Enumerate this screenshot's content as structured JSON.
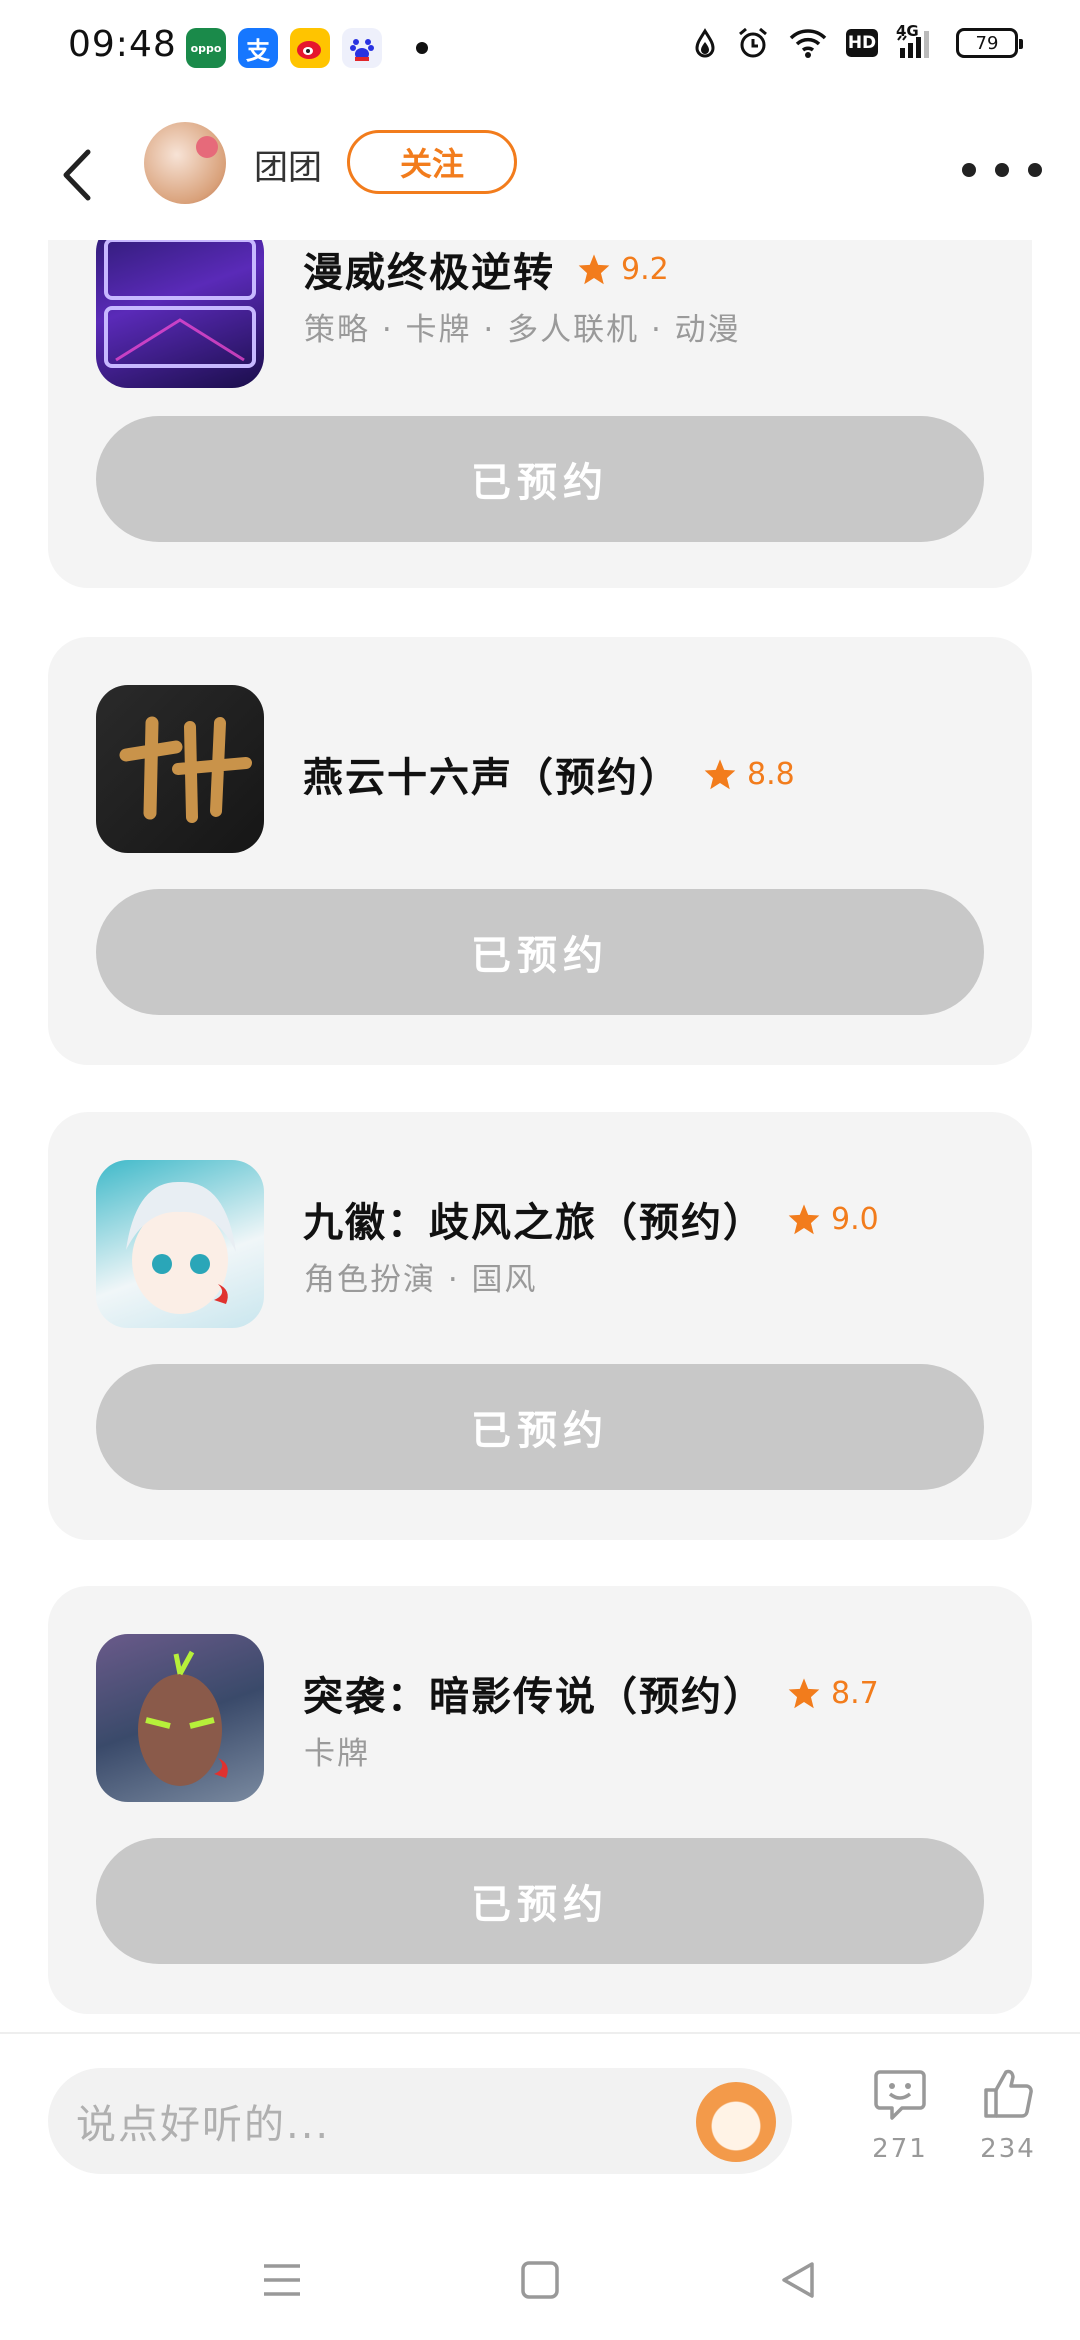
{
  "status_bar": {
    "time": "09:48",
    "network": "4G",
    "hd": "HD",
    "battery": "79",
    "app_icons": [
      {
        "name": "oppo-icon",
        "color": "#1a8a4a",
        "label": "oppo"
      },
      {
        "name": "alipay-icon",
        "color": "#1677ff",
        "label": "支"
      },
      {
        "name": "weibo-icon",
        "color": "#f5b400",
        "label": ""
      },
      {
        "name": "baidu-icon",
        "color": "#e8eaf8",
        "label": ""
      }
    ]
  },
  "header": {
    "username": "团团",
    "follow_label": "关注"
  },
  "games": [
    {
      "title": "漫威终极逆转",
      "rating": "9.2",
      "tags": "策略 · 卡牌 · 多人联机 · 动漫",
      "button": "已预约"
    },
    {
      "title": "燕云十六声（预约）",
      "rating": "8.8",
      "tags": "",
      "button": "已预约"
    },
    {
      "title": "九徽：歧风之旅（预约）",
      "rating": "9.0",
      "tags": "角色扮演 · 国风",
      "button": "已预约"
    },
    {
      "title": "突袭：暗影传说（预约）",
      "rating": "8.7",
      "tags": "卡牌",
      "button": "已预约"
    }
  ],
  "comment_bar": {
    "placeholder": "说点好听的...",
    "comment_count": "271",
    "like_count": "234"
  },
  "colors": {
    "accent": "#f27c1c",
    "card_bg": "#f4f4f4",
    "button_disabled": "#c8c8c8"
  }
}
